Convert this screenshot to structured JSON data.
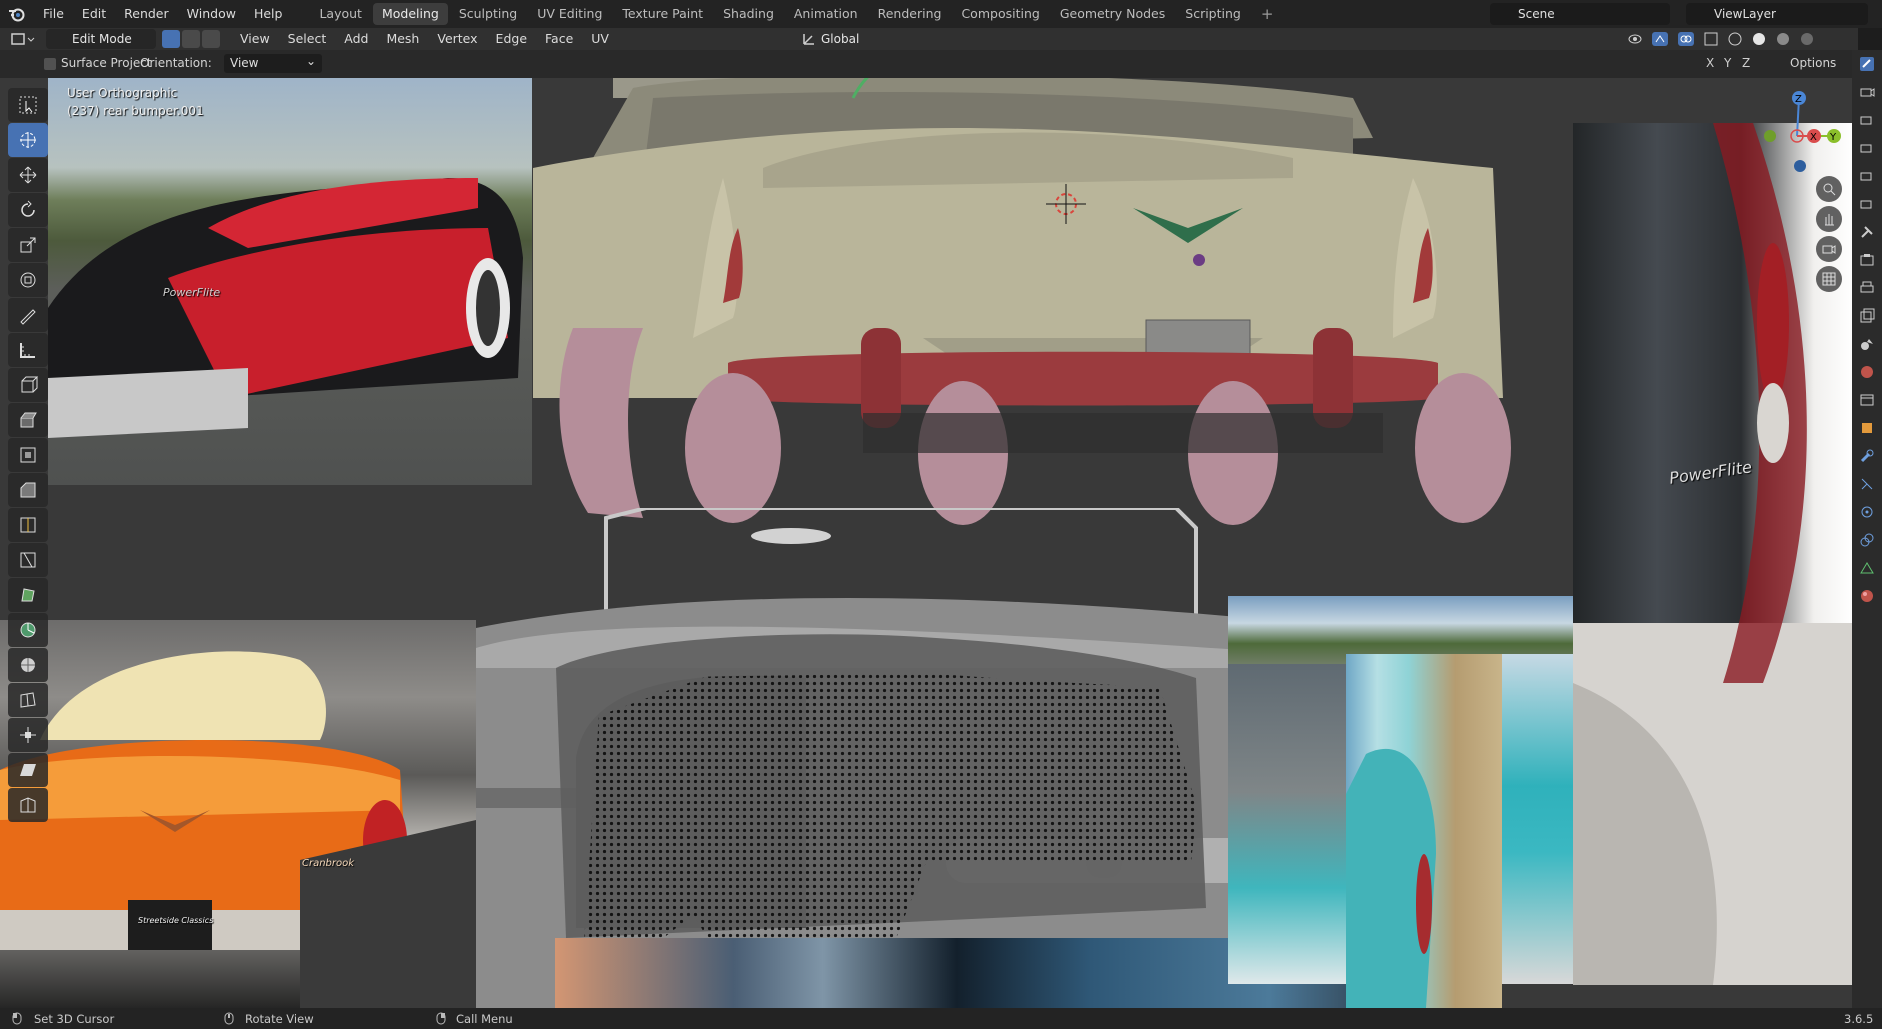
{
  "topbar": {
    "menus": [
      "File",
      "Edit",
      "Render",
      "Window",
      "Help"
    ],
    "workspaces": [
      "Layout",
      "Modeling",
      "Sculpting",
      "UV Editing",
      "Texture Paint",
      "Shading",
      "Animation",
      "Rendering",
      "Compositing",
      "Geometry Nodes",
      "Scripting"
    ],
    "active_workspace": "Modeling",
    "add_workspace": "+",
    "scene": "Scene",
    "view_layer": "ViewLayer"
  },
  "header": {
    "mode": "Edit Mode",
    "menus": [
      "View",
      "Select",
      "Add",
      "Mesh",
      "Vertex",
      "Edge",
      "Face",
      "UV"
    ],
    "transform_orientation": "Global"
  },
  "tool_settings": {
    "surface_project": "Surface Project",
    "orientation_label": "Orientation:",
    "orientation_value": "View",
    "options": "Options",
    "axes": [
      "X",
      "Y",
      "Z"
    ]
  },
  "viewport": {
    "view_name": "User Orthographic",
    "object_info": "(237) rear bumper.001",
    "gizmo_axes": [
      "Z",
      "X",
      "Y"
    ],
    "ref_sign_1": "PowerFlite",
    "ref_plate": "Streetside Classics",
    "ref_script": "Cranbrook"
  },
  "statusbar": {
    "left": "Set 3D Cursor",
    "middle": "Rotate View",
    "right": "Call Menu",
    "version": "3.6.5"
  },
  "colors": {
    "accent": "#4772b3",
    "bg": "#393939",
    "car_body": "#b9b59a",
    "bumper": "#9b3b3e",
    "tires": "#b58e9a"
  }
}
